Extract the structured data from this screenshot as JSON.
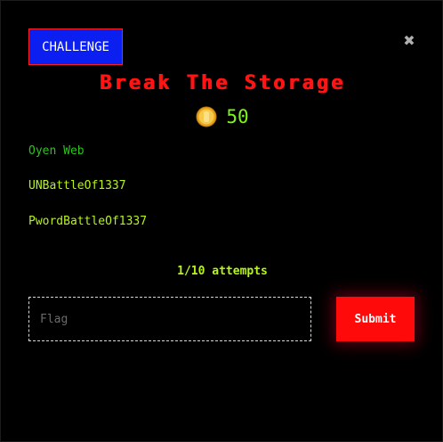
{
  "modal": {
    "category_badge": "CHALLENGE",
    "close_symbol": "✖",
    "title": "Break The Storage",
    "points": "50",
    "points_icon": "coin-icon",
    "author": "Oyen Web",
    "hints": [
      "UNBattleOf1337",
      "PwordBattleOf1337"
    ],
    "attempts": "1/10 attempts",
    "flag_input": {
      "value": "",
      "placeholder": "Flag"
    },
    "submit_label": "Submit"
  },
  "colors": {
    "background": "#000000",
    "badge_bg": "#0b1ff0",
    "badge_border": "#ff1f1f",
    "title": "#ff1414",
    "points": "#7cf51a",
    "author": "#29c41a",
    "hint": "#b6f51a",
    "submit_bg": "#ff0a0a"
  }
}
